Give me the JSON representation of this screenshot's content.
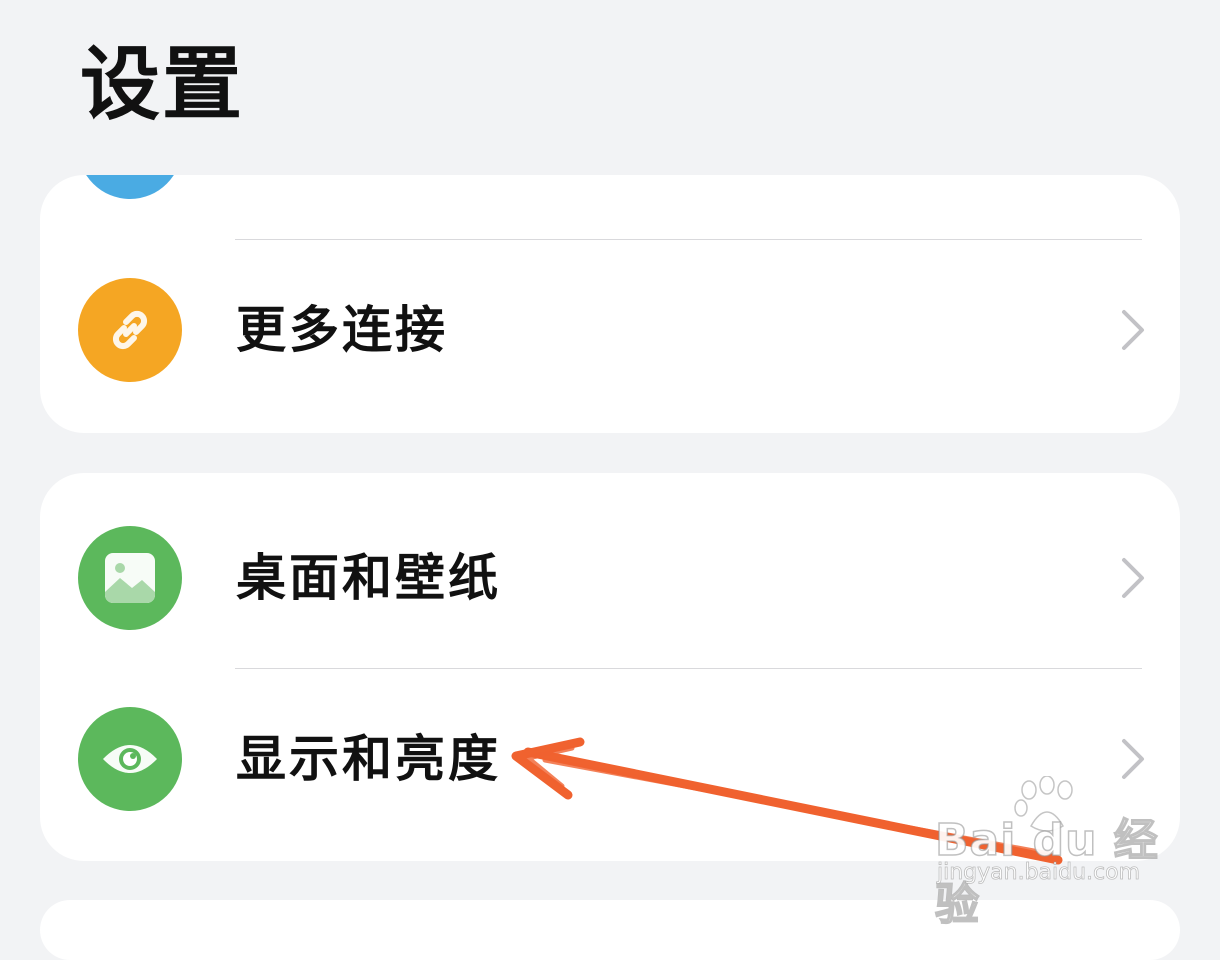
{
  "header": {
    "title": "设置"
  },
  "sections": [
    {
      "items": [
        {
          "label": "",
          "icon": "partial-blue-icon",
          "color": "#4aabe3"
        },
        {
          "label": "更多连接",
          "icon": "link-icon",
          "color": "#f5a623"
        }
      ]
    },
    {
      "items": [
        {
          "label": "桌面和壁纸",
          "icon": "wallpaper-icon",
          "color": "#5cb85c"
        },
        {
          "label": "显示和亮度",
          "icon": "eye-icon",
          "color": "#5cb85c"
        }
      ]
    }
  ],
  "annotation": {
    "type": "arrow",
    "color": "#f0622f",
    "target": "显示和亮度"
  },
  "watermark": {
    "brand": "Bai du 经验",
    "url": "jingyan.baidu.com"
  }
}
